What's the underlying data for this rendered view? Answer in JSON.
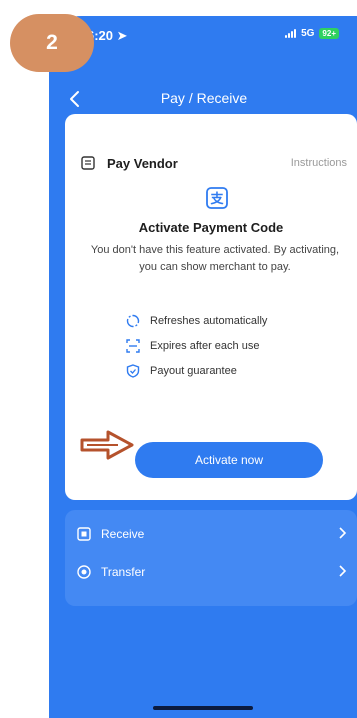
{
  "step_badge": "2",
  "status_bar": {
    "time": "6:20",
    "network": "5G",
    "battery": "92+"
  },
  "nav": {
    "title": "Pay / Receive",
    "back_icon": "chevron-left-icon"
  },
  "card": {
    "title": "Pay Vendor",
    "instructions_link": "Instructions",
    "heading": "Activate Payment Code",
    "description": "You don't have this feature activated. By activating, you can show merchant to pay.",
    "features": [
      {
        "icon": "refresh-icon",
        "label": "Refreshes automatically"
      },
      {
        "icon": "scan-icon",
        "label": "Expires after each use"
      },
      {
        "icon": "shield-icon",
        "label": "Payout guarantee"
      }
    ],
    "activate_button": "Activate now"
  },
  "list": [
    {
      "icon": "receive-icon",
      "label": "Receive"
    },
    {
      "icon": "transfer-icon",
      "label": "Transfer"
    }
  ],
  "colors": {
    "primary": "#2f7bf0",
    "badge": "#d69062",
    "pointer": "#b5522c"
  }
}
